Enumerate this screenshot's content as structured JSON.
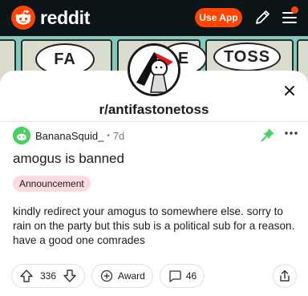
{
  "nav": {
    "brand": "reddit",
    "use_app_label": "Use App",
    "icons": [
      "reddit-logo-icon",
      "pencil-icon",
      "hamburger-menu-icon"
    ],
    "brand_color": "#ff4500"
  },
  "banner": {
    "words": [
      "FA",
      "E",
      "TOSS"
    ]
  },
  "community": {
    "name": "r/antifastonetoss"
  },
  "post": {
    "author": "BananaSquid_",
    "separator": "•",
    "age": "7d",
    "title": "amogus is banned",
    "flair": "Announcement",
    "flair_color": "#fcdbe0",
    "body": "kindly redirect your amogus to somewhere else. sorry to rain on the party but this sub is a political sub for a reason. have a good one comrades",
    "pinned": true
  },
  "actions": {
    "score": "336",
    "award_label": "Award",
    "comments": "46"
  }
}
